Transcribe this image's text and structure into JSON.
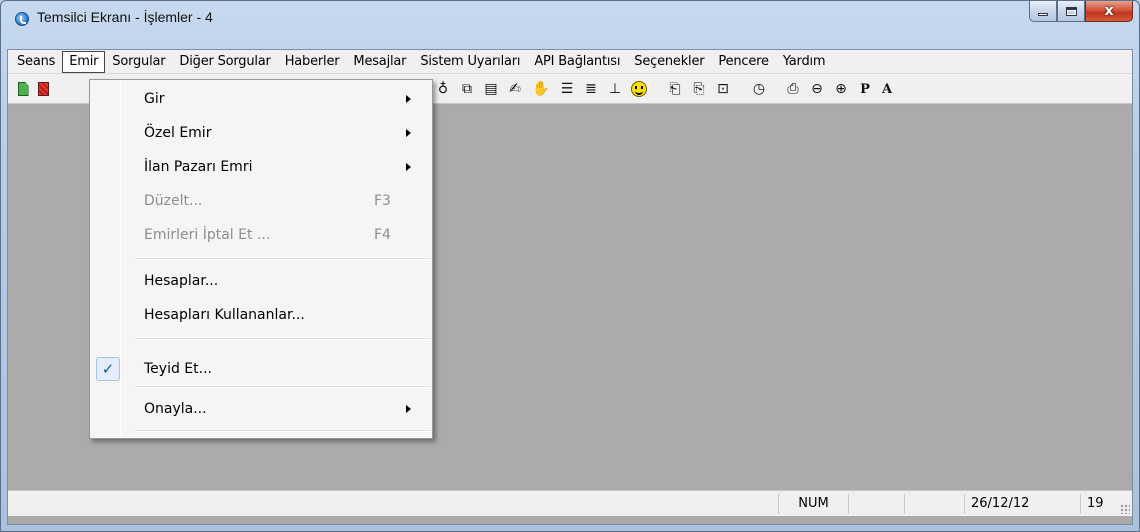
{
  "window": {
    "title": "Temsilci Ekranı - İşlemler - 4",
    "controls": {
      "close_glyph": "x"
    }
  },
  "menubar": {
    "items": [
      {
        "label": "Seans",
        "active": false
      },
      {
        "label": "Emir",
        "active": true
      },
      {
        "label": "Sorgular",
        "active": false
      },
      {
        "label": "Diğer Sorgular",
        "active": false
      },
      {
        "label": "Haberler",
        "active": false
      },
      {
        "label": "Mesajlar",
        "active": false
      },
      {
        "label": "Sistem Uyarıları",
        "active": false
      },
      {
        "label": "API Bağlantısı",
        "active": false
      },
      {
        "label": "Seçenekler",
        "active": false
      },
      {
        "label": "Pencere",
        "active": false
      },
      {
        "label": "Yardım",
        "active": false
      }
    ]
  },
  "toolbar": {
    "icons": [
      {
        "name": "new-document-icon",
        "glyph": ""
      },
      {
        "name": "red-document-icon",
        "glyph": ""
      },
      {
        "name": "weight-icon",
        "glyph": "♁"
      },
      {
        "name": "document-frame-icon",
        "glyph": "⧉"
      },
      {
        "name": "document-list-icon",
        "glyph": "▤"
      },
      {
        "name": "write-icon",
        "glyph": "✍"
      },
      {
        "name": "hand-icon",
        "glyph": "✋"
      },
      {
        "name": "align-lines-icon",
        "glyph": "☰"
      },
      {
        "name": "list-lines-icon",
        "glyph": "≣"
      },
      {
        "name": "gavel-icon",
        "glyph": "⊥"
      },
      {
        "name": "smiley-icon",
        "glyph": ""
      },
      {
        "name": "book-icon",
        "glyph": "⎗"
      },
      {
        "name": "book-open-icon",
        "glyph": "⎘"
      },
      {
        "name": "folder-icon",
        "glyph": "⊡"
      },
      {
        "name": "clock-icon",
        "glyph": "◷"
      },
      {
        "name": "printer-icon",
        "glyph": "⎙"
      },
      {
        "name": "zoom-out-icon",
        "glyph": "⊖"
      },
      {
        "name": "zoom-in-icon",
        "glyph": "⊕"
      },
      {
        "name": "p-icon",
        "glyph": "P"
      },
      {
        "name": "a-icon",
        "glyph": "A"
      }
    ]
  },
  "emir_menu": {
    "items": [
      {
        "label": "Gir",
        "shortcut": "",
        "submenu": true,
        "disabled": false,
        "checked": false
      },
      {
        "label": "Özel Emir",
        "shortcut": "",
        "submenu": true,
        "disabled": false,
        "checked": false
      },
      {
        "label": "İlan Pazarı Emri",
        "shortcut": "",
        "submenu": true,
        "disabled": false,
        "checked": false
      },
      {
        "label": "Düzelt...",
        "shortcut": "F3",
        "submenu": false,
        "disabled": true,
        "checked": false
      },
      {
        "label": "Emirleri İptal Et ...",
        "shortcut": "F4",
        "submenu": false,
        "disabled": true,
        "checked": false
      },
      {
        "label": "Hesaplar...",
        "shortcut": "",
        "submenu": false,
        "disabled": false,
        "checked": false
      },
      {
        "label": "Hesapları Kullananlar...",
        "shortcut": "",
        "submenu": false,
        "disabled": false,
        "checked": false
      },
      {
        "label": "Teyid Et...",
        "shortcut": "",
        "submenu": false,
        "disabled": false,
        "checked": true
      },
      {
        "label": "Onayla...",
        "shortcut": "",
        "submenu": true,
        "disabled": false,
        "checked": false
      }
    ],
    "check_glyph": "✓"
  },
  "statusbar": {
    "num": "NUM",
    "date": "26/12/12",
    "number": "19"
  },
  "colors": {
    "mdi_background": "#ababab",
    "menu_background": "#f5f5f5",
    "disabled_text": "#8d8d8d",
    "close_button": "#c0361d"
  }
}
